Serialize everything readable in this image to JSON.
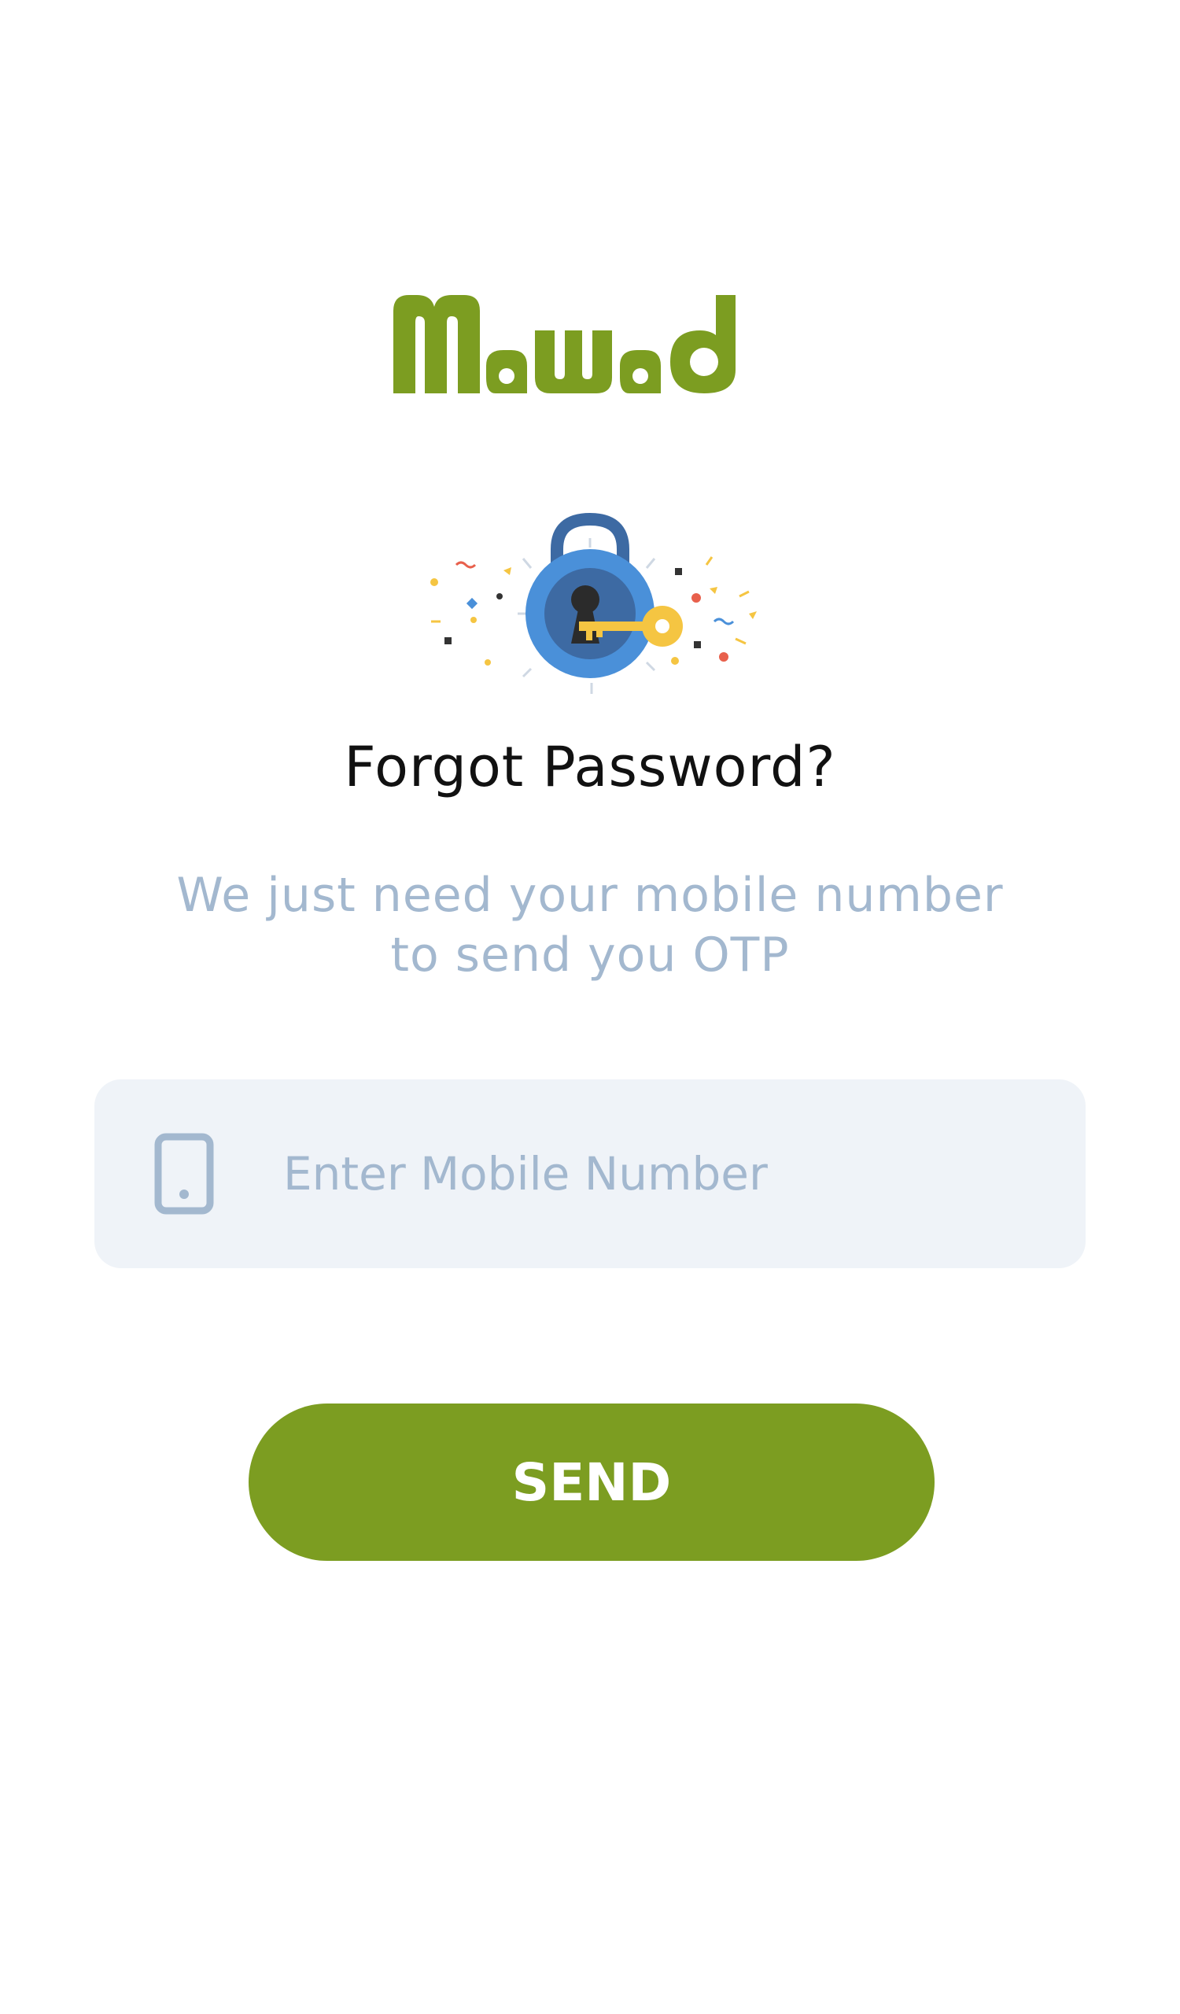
{
  "app": {
    "brand_name": "Mawad",
    "brand_color": "#7c9d21"
  },
  "illustration": {
    "icon": "padlock-with-key-icon"
  },
  "header": {
    "title": "Forgot Password?",
    "subtitle_line1": "We just need your mobile number",
    "subtitle_line2": "to send you OTP"
  },
  "form": {
    "mobile_placeholder": "Enter Mobile Number",
    "mobile_value": "",
    "mobile_icon": "mobile-phone-icon"
  },
  "actions": {
    "send_label": "SEND"
  },
  "colors": {
    "accent": "#7c9d21",
    "muted_text": "#a3b8cf",
    "field_background": "#eff3f8",
    "lock_blue": "#4a90d9",
    "key_yellow": "#f5c542"
  }
}
